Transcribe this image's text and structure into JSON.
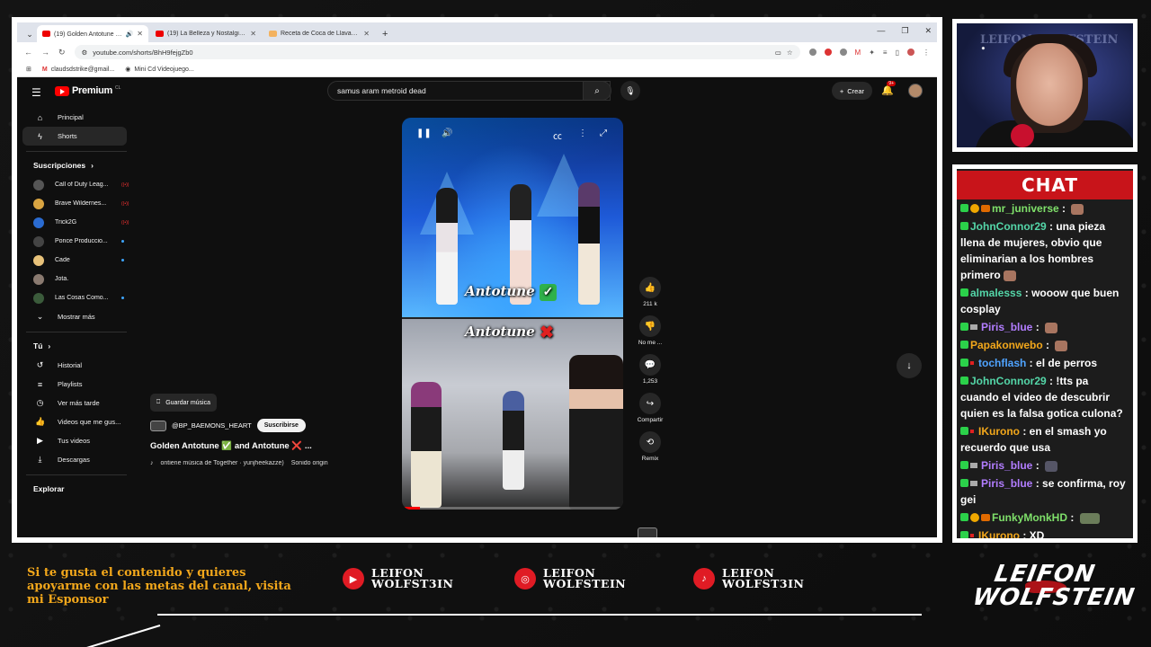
{
  "browser": {
    "tabs": [
      {
        "title": "(19) Golden Antotune ✅ a",
        "active": true
      },
      {
        "title": "(19) La Belleza y Nostalgia de C",
        "active": false
      },
      {
        "title": "Receta de Coca de Llavaneras",
        "active": false
      }
    ],
    "url": "youtube.com/shorts/BhH9fejgZb0",
    "bookmarks": [
      "claudsdstrike@gmail...",
      "Mini Cd Videojuego..."
    ]
  },
  "youtube": {
    "logo_text": "Premium",
    "logo_country": "CL",
    "search_value": "samus aram metroid  dead",
    "create_label": "Crear",
    "notification_badge": "9+",
    "sidebar": {
      "main": [
        {
          "label": "Principal",
          "icon": "home-icon"
        },
        {
          "label": "Shorts",
          "icon": "shorts-icon"
        }
      ],
      "subs_heading": "Suscripciones",
      "subscriptions": [
        {
          "label": "Call of Duty Leag...",
          "live": true
        },
        {
          "label": "Brave Wildernes...",
          "live": true
        },
        {
          "label": "Trick2G",
          "live": true
        },
        {
          "label": "Ponce Produccio...",
          "new": true
        },
        {
          "label": "Cade",
          "new": true
        },
        {
          "label": "Jota.",
          "new": false
        },
        {
          "label": "Las Cosas Como...",
          "new": true
        }
      ],
      "show_more": "Mostrar más",
      "you_heading": "Tú",
      "you_items": [
        {
          "label": "Historial"
        },
        {
          "label": "Playlists"
        },
        {
          "label": "Ver más tarde"
        },
        {
          "label": "Videos que me gus..."
        },
        {
          "label": "Tus videos"
        },
        {
          "label": "Descargas"
        }
      ],
      "explore_heading": "Explorar"
    },
    "short": {
      "caption_top": "Antotune",
      "caption_bottom": "Antotune",
      "progress": 0.08
    },
    "actions": {
      "like_count": "211 k",
      "dislike_label": "No me ...",
      "comments_count": "1,253",
      "share_label": "Compartir",
      "remix_label": "Remix"
    },
    "info": {
      "save_music": "Guardar música",
      "channel": "@BP_BAEMONS_HEART",
      "subscribe": "Suscribirse",
      "title_a": "Golden Antotune",
      "title_b": "and Antotune",
      "title_c": "...",
      "music_text": "ontiene música de Together · yunjheekazze)",
      "original_sound": "Sonido origin"
    }
  },
  "webcam": {
    "watermark": "LEIFON WOLFSTEIN"
  },
  "chat": {
    "title": "CHAT",
    "messages": [
      {
        "user": "mr_juniverse",
        "color": "#7fe06a",
        "text": "",
        "badges": [
          "b",
          "b2",
          "b3"
        ],
        "emote": true
      },
      {
        "user": "JohnConnor29",
        "color": "#54d6a8",
        "text": "una pieza llena de mujeres, obvio que eliminarian a los hombres primero",
        "badges": [
          "b"
        ],
        "emote": true
      },
      {
        "user": "almalesss",
        "color": "#54d6a8",
        "text": "wooow que buen cosplay",
        "badges": [
          "b"
        ],
        "emote": false
      },
      {
        "user": "Piris_blue",
        "color": "#b27dff",
        "text": "",
        "badges": [
          "b",
          "b5"
        ],
        "emote": true
      },
      {
        "user": "Papakonwebo",
        "color": "#f2a71b",
        "text": "",
        "badges": [
          "b"
        ],
        "emote": true
      },
      {
        "user": "tochflash",
        "color": "#4fa3ff",
        "text": "el de perros",
        "badges": [
          "b",
          "b4"
        ],
        "emote": false
      },
      {
        "user": "JohnConnor29",
        "color": "#54d6a8",
        "text": "!tts pa cuando el video de descubrir quien es la falsa gotica culona?",
        "badges": [
          "b"
        ],
        "emote": false
      },
      {
        "user": "IKurono",
        "color": "#f2a71b",
        "text": "en el smash yo recuerdo que usa",
        "badges": [
          "b",
          "b4"
        ],
        "emote": false
      },
      {
        "user": "Piris_blue",
        "color": "#b27dff",
        "text": "",
        "badges": [
          "b",
          "b5"
        ],
        "emote": true
      },
      {
        "user": "Piris_blue",
        "color": "#b27dff",
        "text": "se confirma, roy gei",
        "badges": [
          "b",
          "b5"
        ],
        "emote": false
      },
      {
        "user": "FunkyMonkHD",
        "color": "#7fe06a",
        "text": "",
        "badges": [
          "b",
          "b2",
          "b3"
        ],
        "emote": true
      },
      {
        "user": "IKurono",
        "color": "#f2a71b",
        "text": "XD",
        "badges": [
          "b",
          "b4"
        ],
        "emote": false
      }
    ]
  },
  "overlay": {
    "sponsor_text": "Si te gusta el contenido y quieres apoyarme con las metas del canal, visita mi Esponsor",
    "socials": [
      {
        "icon": "youtube-icon",
        "line1": "LEIFON",
        "line2": "WOLFST3IN"
      },
      {
        "icon": "instagram-icon",
        "line1": "LEIFON",
        "line2": "WOLFSTEIN"
      },
      {
        "icon": "tiktok-icon",
        "line1": "LEIFON",
        "line2": "WOLFST3IN"
      }
    ],
    "brand_line1": "LEIFON",
    "brand_line2": "WOLFSTEIN",
    "accent": "#f2a71b",
    "brand_red": "#c8141a"
  }
}
